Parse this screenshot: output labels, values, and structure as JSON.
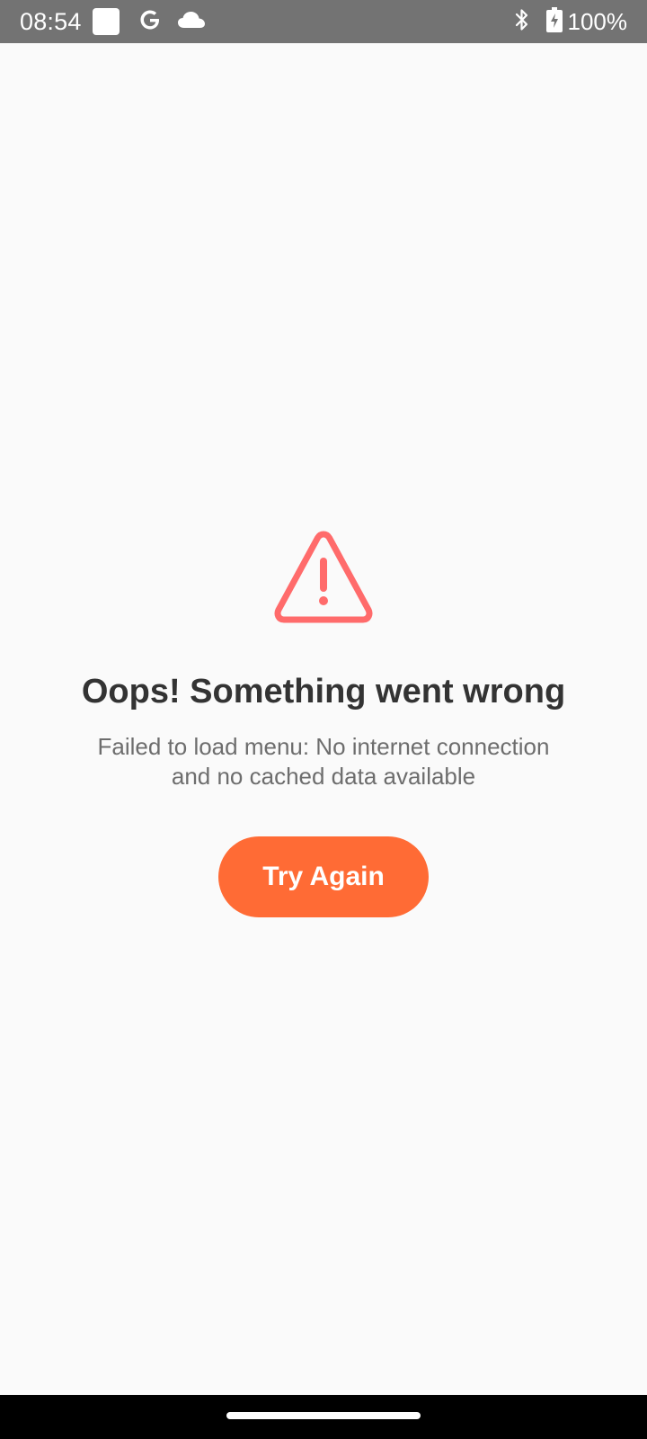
{
  "status_bar": {
    "time": "08:54",
    "battery": "100%",
    "icons": [
      "notification-square-icon",
      "google-icon",
      "cloud-icon",
      "bluetooth-icon",
      "battery-charging-icon"
    ]
  },
  "error": {
    "icon": "warning-triangle-icon",
    "icon_color": "#ff6b6b",
    "title": "Oops! Something went wrong",
    "message_line1": "Failed to load menu: No internet connection",
    "message_line2": "and no cached data available",
    "button_label": "Try Again",
    "button_color": "#ff6b35"
  }
}
